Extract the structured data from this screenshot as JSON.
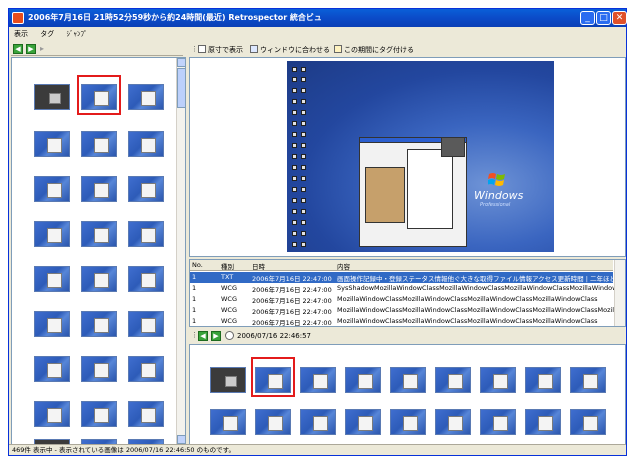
{
  "window": {
    "title": "2006年7月16日 21時52分59秒から約24時間(最近)  Retrospector 統合ビュ",
    "controls": {
      "minimize": "_",
      "maximize": "□",
      "close": "✕"
    }
  },
  "menu": {
    "items": [
      "表示",
      "タグ",
      "ｼﾞｬﾝﾌﾟ"
    ]
  },
  "left_toolbar": {
    "prev_label": "◀",
    "next_label": "▶",
    "forward_arrow": "▸"
  },
  "right_toolbar": {
    "actual_size_label": "原寸で表示",
    "fit_window_label": "ウィンドウに合わせる",
    "add_tag_label": "この期間にタグ付ける"
  },
  "preview": {
    "os_logo_text": "Windows",
    "os_edition_text": "Professional"
  },
  "table": {
    "columns": [
      "No.",
      "種別",
      "日時",
      "内容"
    ],
    "rows": [
      {
        "no": "1",
        "type": "TXT",
        "datetime": "2006年7月16日 22:47:00",
        "content": "画面操作記録中・登録ステータス情報他ぐ大きな取得ファイル情報アクセス更新時間 | 二年ほど前"
      },
      {
        "no": "1",
        "type": "WCG",
        "datetime": "2006年7月16日 22:47:00",
        "content": "SysShadowMozillaWindowClassMozillaWindowClassMozillaWindowClassMozillaWindowCL"
      },
      {
        "no": "1",
        "type": "WCG",
        "datetime": "2006年7月16日 22:47:00",
        "content": "MozillaWindowClassMozillaWindowClassMozillaWindowClassMozillaWindowClass"
      },
      {
        "no": "1",
        "type": "WCG",
        "datetime": "2006年7月16日 22:47:00",
        "content": "MozillaWindowClassMozillaWindowClassMozillaWindowClassMozillaWindowClassMozillaW"
      },
      {
        "no": "1",
        "type": "WCG",
        "datetime": "2006年7月16日 22:47:00",
        "content": "MozillaWindowClassMozillaWindowClassMozillaWindowClassMozillaWindowClass"
      }
    ]
  },
  "strip_toolbar": {
    "timestamp": "2006/07/16 22:46:57"
  },
  "status_bar": {
    "text": "469件 表示中 - 表示されている画像は 2006/07/16 22:46:50 のものです。"
  }
}
